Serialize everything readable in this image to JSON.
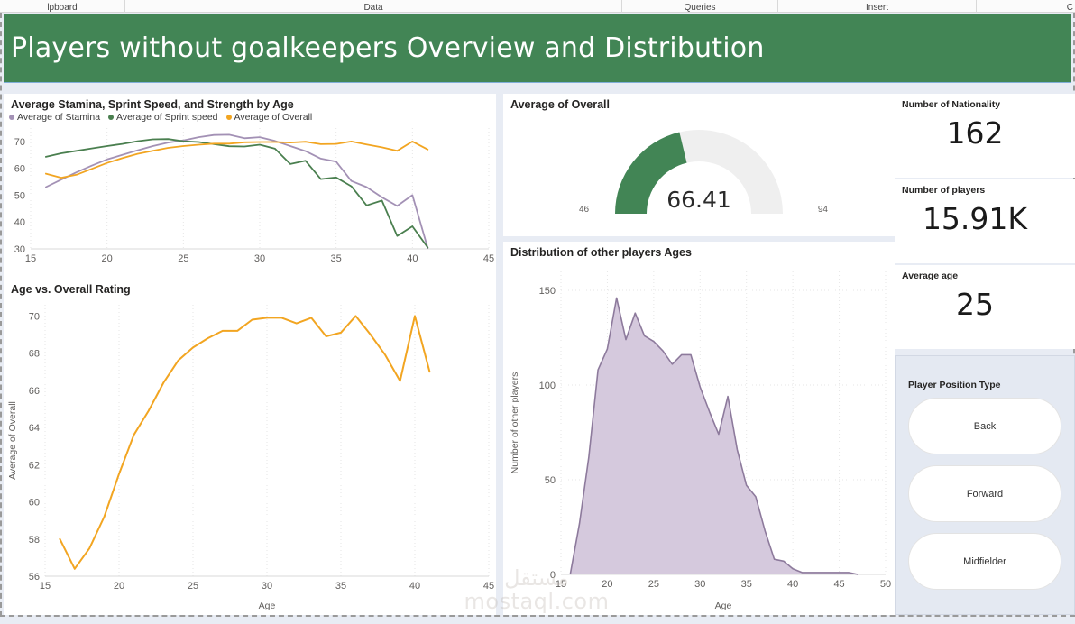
{
  "ribbon": {
    "groups": [
      "lpboard",
      "Data",
      "Queries",
      "Insert",
      "C"
    ]
  },
  "banner": {
    "title": "Players without goalkeepers Overview and Distribution",
    "background": "#428555",
    "text_color": "#ffffff"
  },
  "watermark": {
    "line1": "مستقل",
    "line2": "mostaql.com"
  },
  "colors": {
    "stamina": "#a391b5",
    "sprint": "#4a7f4f",
    "overall": "#f2a521",
    "green": "#428555",
    "gauge_track": "#efefef"
  },
  "panels": {
    "line_chart": {
      "title": "Average Stamina, Sprint Speed, and Strength by Age"
    },
    "overall_chart": {
      "title": "Age vs. Overall Rating"
    },
    "gauge": {
      "title": "Average of Overall"
    },
    "distribution": {
      "title": "Distribution of other players Ages"
    }
  },
  "kpis": [
    {
      "label": "Number of Nationality",
      "value": "162"
    },
    {
      "label": "Number of players",
      "value": "15.91K"
    },
    {
      "label": "Average age",
      "value": "25"
    }
  ],
  "slicer": {
    "title": "Player Position Type",
    "options": [
      "Back",
      "Forward",
      "Midfielder"
    ]
  },
  "chart_data": [
    {
      "id": "line_chart",
      "type": "line",
      "title": "Average Stamina, Sprint Speed, and Strength by Age",
      "xlabel": "",
      "ylabel": "",
      "xlim": [
        15,
        45
      ],
      "ylim": [
        30,
        75
      ],
      "xticks": [
        15,
        20,
        25,
        30,
        35,
        40,
        45
      ],
      "yticks": [
        30,
        40,
        50,
        60,
        70
      ],
      "grid": true,
      "legend_position": "top-left",
      "x": [
        16,
        17,
        18,
        19,
        20,
        21,
        22,
        23,
        24,
        25,
        26,
        27,
        28,
        29,
        30,
        31,
        32,
        33,
        34,
        35,
        36,
        37,
        38,
        39,
        40,
        41
      ],
      "series": [
        {
          "name": "Average of Stamina",
          "color": "#a391b5",
          "values": [
            53.0,
            55.8,
            58.5,
            61.0,
            63.3,
            65.0,
            66.7,
            68.3,
            69.6,
            70.4,
            71.6,
            72.4,
            72.5,
            71.2,
            71.6,
            70.2,
            68.3,
            66.4,
            63.6,
            62.5,
            55.3,
            53.0,
            49.2,
            46.0,
            50.0,
            30.3
          ]
        },
        {
          "name": "Average of Sprint speed",
          "color": "#4a7f4f",
          "values": [
            64.3,
            65.6,
            66.5,
            67.4,
            68.3,
            69.1,
            70.1,
            70.8,
            70.9,
            70.1,
            69.8,
            69.0,
            68.2,
            68.1,
            68.8,
            67.3,
            61.6,
            62.8,
            56.0,
            56.6,
            53.3,
            46.2,
            48.0,
            34.8,
            38.4,
            30.5
          ]
        },
        {
          "name": "Average of Overall",
          "color": "#f2a521",
          "values": [
            58.0,
            56.5,
            57.6,
            59.8,
            62.0,
            63.8,
            65.4,
            66.5,
            67.6,
            68.3,
            68.8,
            69.2,
            69.2,
            69.7,
            69.8,
            69.8,
            69.6,
            69.9,
            69.0,
            69.1,
            70.0,
            68.9,
            67.8,
            66.5,
            70.0,
            67.0
          ]
        }
      ]
    },
    {
      "id": "overall_chart",
      "type": "line",
      "title": "Age vs. Overall Rating",
      "xlabel": "Age",
      "ylabel": "Average of Overall",
      "xlim": [
        15,
        45
      ],
      "ylim": [
        56,
        70.6
      ],
      "xticks": [
        15,
        20,
        25,
        30,
        35,
        40,
        45
      ],
      "yticks": [
        56,
        58,
        60,
        62,
        64,
        66,
        68,
        70
      ],
      "grid": true,
      "color": "#f2a521",
      "x": [
        16,
        17,
        18,
        19,
        20,
        21,
        22,
        23,
        24,
        25,
        26,
        27,
        28,
        29,
        30,
        31,
        32,
        33,
        34,
        35,
        36,
        37,
        38,
        39,
        40,
        41
      ],
      "values": [
        58.0,
        56.4,
        57.5,
        59.2,
        61.5,
        63.6,
        64.9,
        66.4,
        67.6,
        68.3,
        68.8,
        69.2,
        69.2,
        69.8,
        69.9,
        69.9,
        69.6,
        69.9,
        68.9,
        69.1,
        70.0,
        69.0,
        67.9,
        66.5,
        70.0,
        67.0
      ]
    },
    {
      "id": "gauge",
      "type": "gauge",
      "title": "Average of Overall",
      "value": 66.41,
      "value_label": "66.41",
      "min": 46,
      "max": 94,
      "min_label": "46",
      "max_label": "94",
      "fill_color": "#428555",
      "track_color": "#efefef"
    },
    {
      "id": "distribution",
      "type": "area",
      "title": "Distribution of other players Ages",
      "xlabel": "Age",
      "ylabel": "Number of other players",
      "xlim": [
        15,
        50
      ],
      "ylim": [
        0,
        160
      ],
      "xticks": [
        15,
        20,
        25,
        30,
        35,
        40,
        45,
        50
      ],
      "yticks": [
        0,
        50,
        100,
        150
      ],
      "grid": true,
      "line_color": "#8d7a9c",
      "fill_color": "#d5c9dd",
      "x": [
        16,
        17,
        18,
        19,
        20,
        21,
        22,
        23,
        24,
        25,
        26,
        27,
        28,
        29,
        30,
        31,
        32,
        33,
        34,
        35,
        36,
        37,
        38,
        39,
        40,
        41,
        42,
        43,
        44,
        45,
        46,
        47
      ],
      "values": [
        0,
        27,
        62,
        108,
        119,
        146,
        124,
        138,
        126,
        123,
        118,
        111,
        116,
        116,
        99,
        86,
        74,
        94,
        66,
        47,
        41,
        23,
        8,
        7,
        3,
        1,
        1,
        1,
        1,
        1,
        1,
        0
      ]
    }
  ]
}
